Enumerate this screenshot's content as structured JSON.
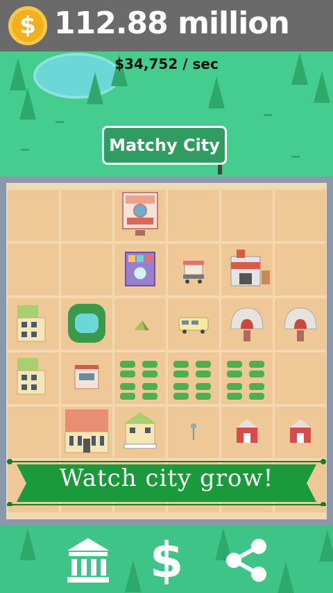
{
  "header": {
    "coin_symbol": "$",
    "money": "112.88 million",
    "rate": "$34,752 / sec"
  },
  "city_sign": {
    "label": "Matchy City"
  },
  "banner": {
    "text": "Watch city grow!"
  },
  "bottom_nav": {
    "items": [
      {
        "icon": "bank-icon"
      },
      {
        "icon": "dollar-icon",
        "glyph": "$"
      },
      {
        "icon": "share-icon"
      }
    ]
  },
  "grid": {
    "rows": 6,
    "cols": 6,
    "tiles": [
      [
        "empty",
        "empty",
        "theater",
        "empty",
        "empty",
        "empty"
      ],
      [
        "empty",
        "empty",
        "mall",
        "food-cart",
        "factory",
        "empty"
      ],
      [
        "apartment",
        "park",
        "tent",
        "camper-van",
        "pottery-kiln",
        "pottery-kiln"
      ],
      [
        "apartment",
        "shop",
        "crop-field",
        "crop-field",
        "crop-field",
        "empty"
      ],
      [
        "empty",
        "town-hall",
        "house",
        "sprout",
        "barn",
        "barn"
      ],
      [
        "empty",
        "empty",
        "empty",
        "empty",
        "empty",
        "empty"
      ]
    ]
  },
  "colors": {
    "top_bar": "#6a6a6a",
    "grass": "#45cc8f",
    "board_frame": "#8a98ab",
    "tile": "#efc898",
    "banner_green": "#1a9a3a",
    "coin": "#f2b01e"
  }
}
